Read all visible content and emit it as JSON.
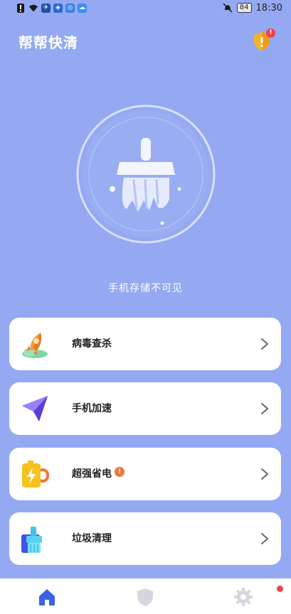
{
  "status_bar": {
    "battery_level": "84",
    "time": "18:30",
    "left_icons": [
      "alert-icon",
      "wifi-icon",
      "bird-app-icon",
      "shield-app-icon",
      "browser-app-icon",
      "cloud-app-icon"
    ],
    "right_icons": [
      "mute-bell-icon",
      "battery-icon"
    ]
  },
  "header": {
    "title": "帮帮快清",
    "notification_badge": "!"
  },
  "hero": {
    "storage_status": "手机存储不可见"
  },
  "features": [
    {
      "label": "病毒查杀",
      "icon": "rocket-icon",
      "badge": ""
    },
    {
      "label": "手机加速",
      "icon": "paper-plane-icon",
      "badge": ""
    },
    {
      "label": "超强省电",
      "icon": "battery-bolt-icon",
      "badge": "!"
    },
    {
      "label": "垃圾清理",
      "icon": "trash-brush-icon",
      "badge": ""
    }
  ],
  "bottom_nav": {
    "items": [
      "home-icon",
      "shield-icon",
      "settings-icon"
    ],
    "active": "home-icon"
  },
  "colors": {
    "background": "#94a9f2",
    "card": "#ffffff",
    "badge": "#f0783c",
    "active_nav": "#3a64e6"
  }
}
